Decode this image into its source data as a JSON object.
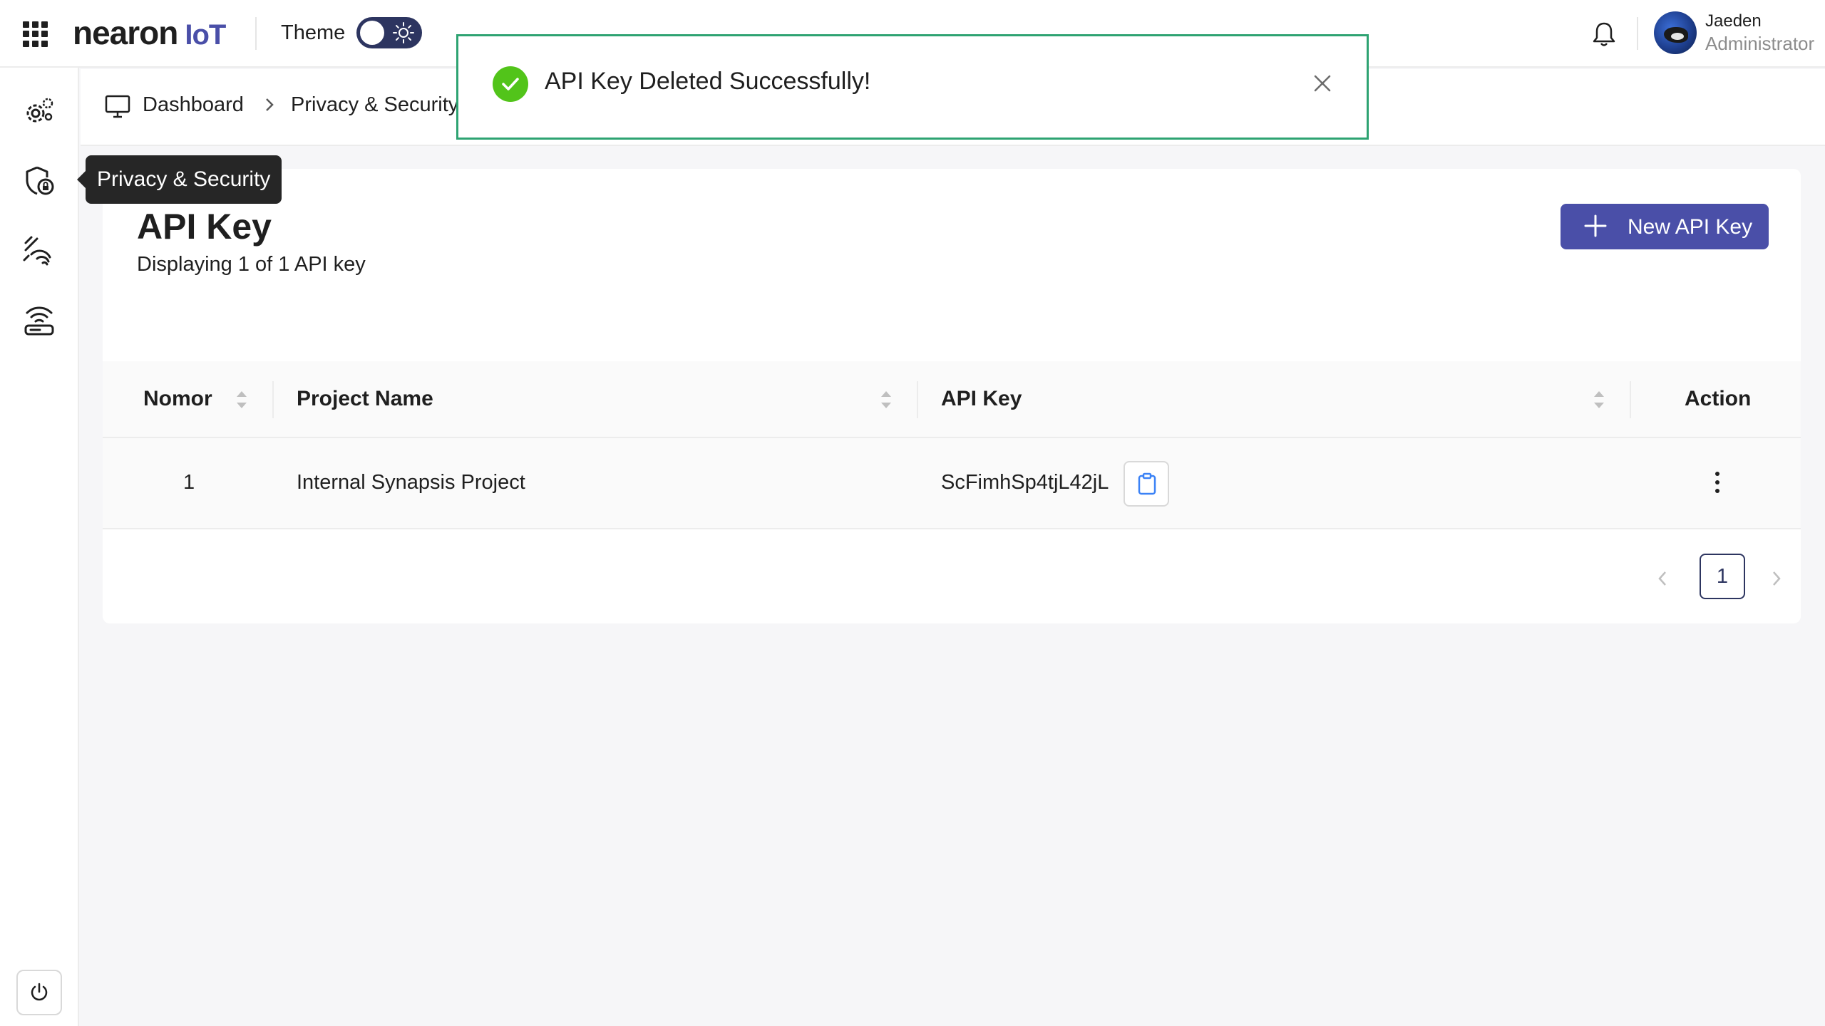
{
  "header": {
    "logo_main": "nearon",
    "logo_accent": "IoT",
    "theme_label": "Theme",
    "user_name": "Jaeden",
    "user_role": "Administrator"
  },
  "sidebar": {
    "items": [
      {
        "icon": "gear-cluster-icon"
      },
      {
        "icon": "shield-lock-icon"
      },
      {
        "icon": "signal-icon"
      },
      {
        "icon": "router-icon"
      }
    ],
    "tooltip": "Privacy & Security"
  },
  "breadcrumb": {
    "items": [
      "Dashboard",
      "Privacy & Security"
    ]
  },
  "toast": {
    "message": "API Key Deleted Successfully!"
  },
  "page": {
    "title": "API Key",
    "subtitle": "Displaying 1 of 1 API key",
    "new_button": "New API Key"
  },
  "table": {
    "columns": [
      "Nomor",
      "Project Name",
      "API Key",
      "Action"
    ],
    "rows": [
      {
        "nomor": "1",
        "project_name": "Internal Synapsis Project",
        "api_key": "ScFimhSp4tjL42jL"
      }
    ]
  },
  "pagination": {
    "current_page": "1"
  },
  "colors": {
    "brand": "#4a4fa8",
    "toggle": "#2d3560",
    "success": "#52c41a",
    "toast_border": "#2ea372"
  }
}
